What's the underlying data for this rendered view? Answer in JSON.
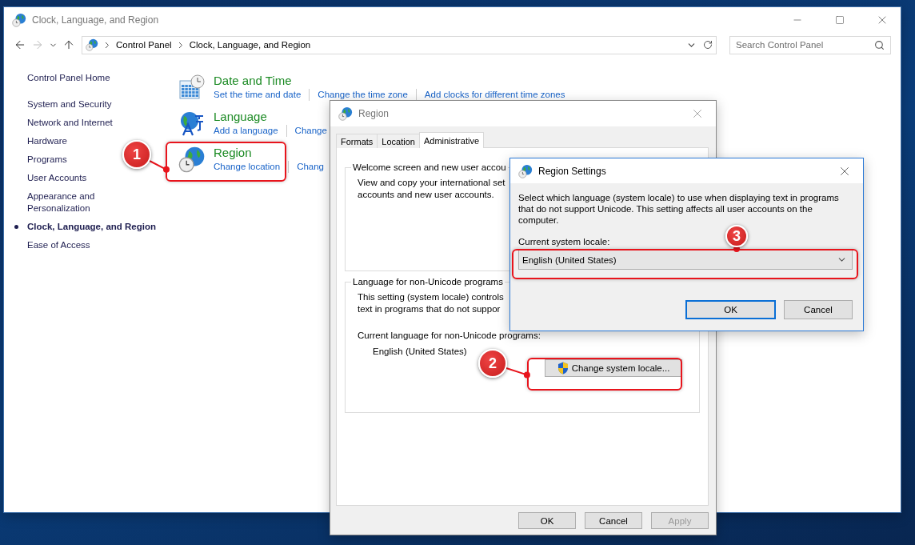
{
  "main_window": {
    "title": "Clock, Language, and Region",
    "breadcrumb": [
      "Control Panel",
      "Clock, Language, and Region"
    ],
    "search": {
      "placeholder": "Search Control Panel"
    },
    "sidebar": {
      "items": [
        {
          "label": "Control Panel Home",
          "selected": false
        },
        {
          "label": "System and Security",
          "selected": false
        },
        {
          "label": "Network and Internet",
          "selected": false
        },
        {
          "label": "Hardware",
          "selected": false
        },
        {
          "label": "Programs",
          "selected": false
        },
        {
          "label": "User Accounts",
          "selected": false
        },
        {
          "label": "Appearance and Personalization",
          "selected": false
        },
        {
          "label": "Clock, Language, and Region",
          "selected": true
        },
        {
          "label": "Ease of Access",
          "selected": false
        }
      ]
    },
    "categories": [
      {
        "kind": "datetime",
        "title": "Date and Time",
        "links": [
          "Set the time and date",
          "Change the time zone",
          "Add clocks for different time zones"
        ]
      },
      {
        "kind": "language",
        "title": "Language",
        "links": [
          "Add a language",
          "Change"
        ]
      },
      {
        "kind": "region",
        "title": "Region",
        "links": [
          "Change location",
          "Chang"
        ]
      }
    ]
  },
  "region_dialog": {
    "title": "Region",
    "tabs": [
      {
        "label": "Formats",
        "selected": false
      },
      {
        "label": "Location",
        "selected": false
      },
      {
        "label": "Administrative",
        "selected": true
      }
    ],
    "groups": [
      {
        "legend": "Welcome screen and new user accou",
        "text": [
          "View and copy your international set",
          "accounts and new user accounts."
        ]
      },
      {
        "legend": "Language for non-Unicode programs",
        "text": [
          "This setting (system locale) controls",
          "text in programs that do not suppor"
        ],
        "current_label": "Current language for non-Unicode programs:",
        "current_value": "English (United States)",
        "button": "Change system locale..."
      }
    ],
    "buttons": [
      {
        "label": "OK",
        "disabled": false
      },
      {
        "label": "Cancel",
        "disabled": false
      },
      {
        "label": "Apply",
        "disabled": true
      }
    ]
  },
  "region_settings_dialog": {
    "title": "Region Settings",
    "description": "Select which language (system locale) to use when displaying text in programs that do not support Unicode. This setting affects all user accounts on the computer.",
    "locale_label": "Current system locale:",
    "locale_value": "English (United States)",
    "buttons": [
      {
        "label": "OK",
        "default": true
      },
      {
        "label": "Cancel",
        "default": false
      }
    ]
  },
  "callouts": [
    {
      "number": "1"
    },
    {
      "number": "2"
    },
    {
      "number": "3"
    }
  ]
}
